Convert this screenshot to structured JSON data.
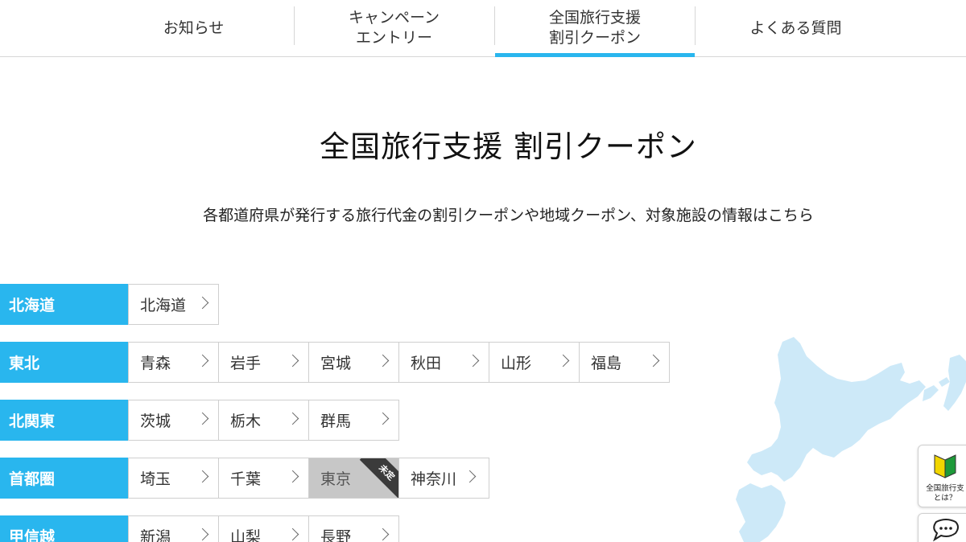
{
  "nav": {
    "tabs": [
      {
        "label": "お知らせ",
        "active": false
      },
      {
        "label": "キャンペーン\nエントリー",
        "active": false
      },
      {
        "label": "全国旅行支援\n割引クーポン",
        "active": true
      },
      {
        "label": "よくある質問",
        "active": false
      }
    ],
    "accent_color": "#29b6ee"
  },
  "main": {
    "title": "全国旅行支援 割引クーポン",
    "description": "各都道府県が発行する旅行代金の割引クーポンや地域クーポン、対象施設の情報はこちら"
  },
  "regions": [
    {
      "name": "北海道",
      "prefectures": [
        {
          "name": "北海道"
        }
      ]
    },
    {
      "name": "東北",
      "prefectures": [
        {
          "name": "青森"
        },
        {
          "name": "岩手"
        },
        {
          "name": "宮城"
        },
        {
          "name": "秋田"
        },
        {
          "name": "山形"
        },
        {
          "name": "福島"
        }
      ]
    },
    {
      "name": "北関東",
      "prefectures": [
        {
          "name": "茨城"
        },
        {
          "name": "栃木"
        },
        {
          "name": "群馬"
        }
      ]
    },
    {
      "name": "首都圏",
      "prefectures": [
        {
          "name": "埼玉"
        },
        {
          "name": "千葉"
        },
        {
          "name": "東京",
          "badge": "未定",
          "disabled": true
        },
        {
          "name": "神奈川"
        }
      ]
    },
    {
      "name": "甲信越",
      "prefectures": [
        {
          "name": "新潟"
        },
        {
          "name": "山梨"
        },
        {
          "name": "長野"
        }
      ]
    }
  ],
  "side": {
    "guide_label": "全国旅行支\nとは？",
    "guide_icon": "beginner-mark-icon",
    "chat_icon": "chat-bubble-icon"
  },
  "colors": {
    "region_label_bg": "#29b6ee",
    "map_fill": "#cde9f8",
    "disabled_bg": "#c7c7c7",
    "badge_bg": "#3b3b3b"
  }
}
